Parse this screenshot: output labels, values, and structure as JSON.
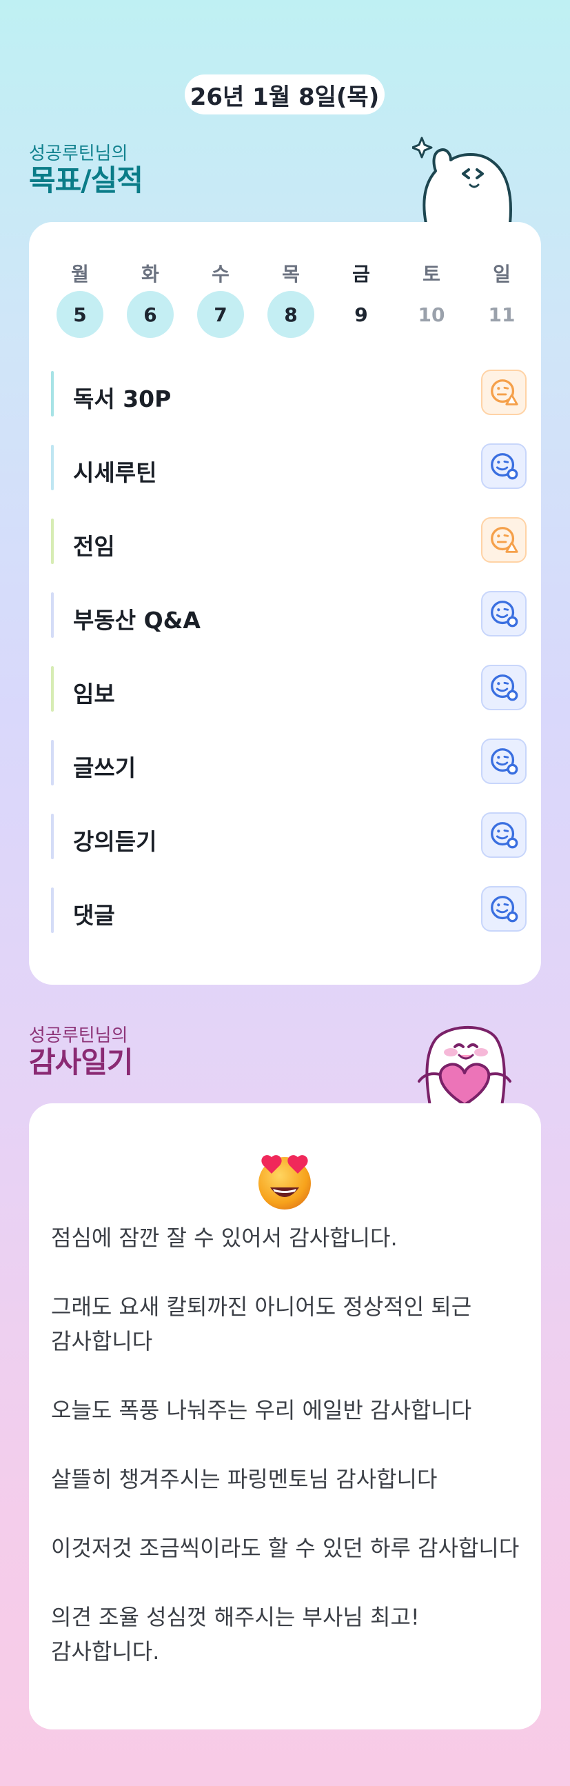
{
  "header": {
    "date": "26년 1월 8일(목)"
  },
  "goals_section": {
    "subtitle": "성공루틴님의",
    "title": "목표/실적"
  },
  "week": [
    {
      "name": "월",
      "date": "5",
      "state": "done"
    },
    {
      "name": "화",
      "date": "6",
      "state": "done"
    },
    {
      "name": "수",
      "date": "7",
      "state": "done"
    },
    {
      "name": "목",
      "date": "8",
      "state": "done"
    },
    {
      "name": "금",
      "date": "9",
      "state": "today"
    },
    {
      "name": "토",
      "date": "10",
      "state": "future"
    },
    {
      "name": "일",
      "date": "11",
      "state": "future"
    }
  ],
  "tasks": [
    {
      "label": "독서 30P",
      "bar_color": "#a7e3e6",
      "status": "partial",
      "icon": "smile-triangle-icon"
    },
    {
      "label": "시세루틴",
      "bar_color": "#bfe6f2",
      "status": "complete",
      "icon": "smile-circle-icon"
    },
    {
      "label": "전임",
      "bar_color": "#d7ecb4",
      "status": "partial",
      "icon": "smile-triangle-icon"
    },
    {
      "label": "부동산 Q&A",
      "bar_color": "#d4dcf7",
      "status": "complete",
      "icon": "smile-circle-icon"
    },
    {
      "label": "임보",
      "bar_color": "#d7ecb4",
      "status": "complete",
      "icon": "smile-circle-icon"
    },
    {
      "label": "글쓰기",
      "bar_color": "#d4dcf7",
      "status": "complete",
      "icon": "smile-circle-icon"
    },
    {
      "label": "강의듣기",
      "bar_color": "#d4dcf7",
      "status": "complete",
      "icon": "smile-circle-icon"
    },
    {
      "label": "댓글",
      "bar_color": "#d4dcf7",
      "status": "complete",
      "icon": "smile-circle-icon"
    }
  ],
  "thanks_section": {
    "subtitle": "성공루틴님의",
    "title": "감사일기"
  },
  "gratitude": {
    "emoji": "heart-eyes-emoji",
    "entries": [
      "점심에 잠깐 잘 수 있어서 감사합니다.",
      "그래도 요새 칼퇴까진 아니어도 정상적인 퇴근 감사합니다",
      "오늘도 폭풍 나눠주는 우리 에일반 감사합니다",
      "살뜰히 챙겨주시는 파링멘토님 감사합니다",
      "이것저것 조금씩이라도 할 수 있던 하루 감사합니다",
      "의견 조율 성심껏 해주시는 부사님 최고! 감사합니다."
    ]
  },
  "colors": {
    "accent_teal": "#0a7c88",
    "accent_magenta": "#8a2a73",
    "done_day": "#c4eef3",
    "partial": "#f5a04a",
    "complete": "#3a6fe0"
  }
}
